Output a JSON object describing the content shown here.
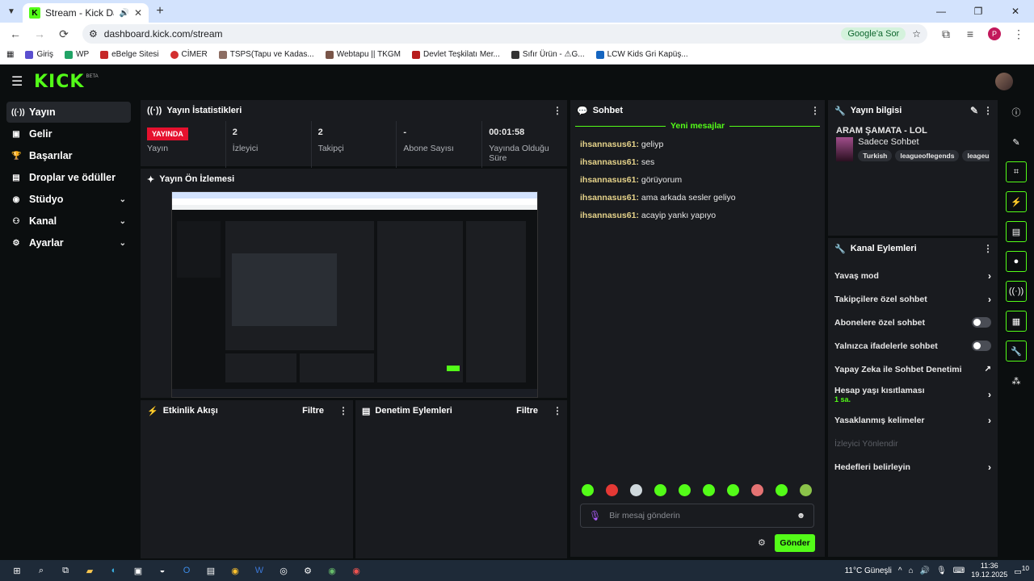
{
  "browser": {
    "tab_title": "Stream - Kick Dashboard",
    "url": "dashboard.kick.com/stream",
    "google_ask": "Google'a Sor",
    "profile_initial": "P",
    "bookmarks": [
      "Giriş",
      "WP",
      "eBelge Sitesi",
      "CİMER",
      "TSPS(Tapu ve Kadas...",
      "Webtapu || TKGM",
      "Devlet Teşkilatı Mer...",
      "Sıfır Ürün - ⚠G...",
      "LCW Kids Gri Kapüş..."
    ]
  },
  "kick": {
    "logo": "KICK",
    "beta": "BETA",
    "brand_color": "#53fc18"
  },
  "sidebar": {
    "items": [
      {
        "label": "Yayın",
        "icon": "broadcast-icon"
      },
      {
        "label": "Gelir",
        "icon": "revenue-icon"
      },
      {
        "label": "Başarılar",
        "icon": "trophy-icon"
      },
      {
        "label": "Droplar ve ödüller",
        "icon": "gift-icon"
      },
      {
        "label": "Stüdyo",
        "icon": "studio-icon"
      },
      {
        "label": "Kanal",
        "icon": "channel-icon"
      },
      {
        "label": "Ayarlar",
        "icon": "gear-icon"
      }
    ]
  },
  "stats": {
    "title": "Yayın İstatistikleri",
    "live_badge": "YAYINDA",
    "items": [
      {
        "value": "",
        "label": "Yayın"
      },
      {
        "value": "2",
        "label": "İzleyici"
      },
      {
        "value": "2",
        "label": "Takipçi"
      },
      {
        "value": "-",
        "label": "Abone Sayısı"
      },
      {
        "value": "00:01:58",
        "label": "Yayında Olduğu Süre"
      }
    ]
  },
  "preview": {
    "title": "Yayın Ön İzlemesi"
  },
  "activity": {
    "title": "Etkinlik Akışı",
    "filter": "Filtre"
  },
  "moderation": {
    "title": "Denetim Eylemleri",
    "filter": "Filtre"
  },
  "chat": {
    "title": "Sohbet",
    "new_messages": "Yeni mesajlar",
    "messages": [
      {
        "user": "ihsannasus61:",
        "text": "geliyp"
      },
      {
        "user": "ihsannasus61:",
        "text": "ses"
      },
      {
        "user": "ihsannasus61:",
        "text": "görüyorum"
      },
      {
        "user": "ihsannasus61:",
        "text": "ama arkada sesler geliyo"
      },
      {
        "user": "ihsannasus61:",
        "text": "acayip yankı yapıyo"
      }
    ],
    "placeholder": "Bir mesaj gönderin",
    "send": "Gönder"
  },
  "stream_info": {
    "title": "Yayın bilgisi",
    "stream_title": "ARAM ŞAMATA - LOL",
    "category": "Sadece Sohbet",
    "tags": [
      "Turkish",
      "leagueoflegends",
      "leageu"
    ]
  },
  "channel_actions": {
    "title": "Kanal Eylemleri",
    "items": [
      {
        "label": "Yavaş mod",
        "control": "arrow"
      },
      {
        "label": "Takipçilere özel sohbet",
        "control": "arrow"
      },
      {
        "label": "Abonelere özel sohbet",
        "control": "toggle"
      },
      {
        "label": "Yalnızca ifadelerle sohbet",
        "control": "toggle"
      },
      {
        "label": "Yapay Zeka ile Sohbet Denetimi",
        "control": "external"
      },
      {
        "label": "Hesap yaşı kısıtlaması",
        "sub": "1 sa.",
        "control": "arrow"
      },
      {
        "label": "Yasaklanmış kelimeler",
        "control": "arrow"
      },
      {
        "label": "İzleyici Yönlendir",
        "control": "none",
        "disabled": true
      },
      {
        "label": "Hedefleri belirleyin",
        "control": "arrow"
      }
    ]
  },
  "taskbar": {
    "weather": "11°C  Güneşli",
    "time": "11:36",
    "date": "19.12.2025",
    "notif": "10"
  }
}
